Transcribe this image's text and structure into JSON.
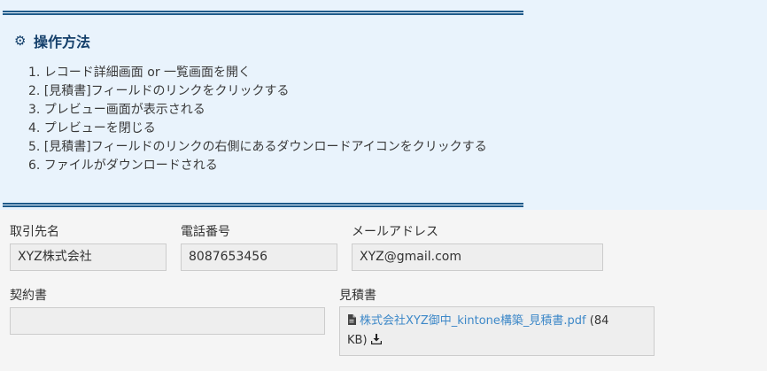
{
  "info_panel": {
    "title": "操作方法",
    "title_icon": "gear-icon",
    "steps": [
      "1. レコード詳細画面 or 一覧画面を開く",
      "2. [見積書]フィールドのリンクをクリックする",
      "3. プレビュー画面が表示される",
      "4. プレビューを閉じる",
      "5. [見積書]フィールドのリンクの右側にあるダウンロードアイコンをクリックする",
      "6. ファイルがダウンロードされる"
    ]
  },
  "form": {
    "customer": {
      "label": "取引先名",
      "value": "XYZ株式会社"
    },
    "phone": {
      "label": "電話番号",
      "value": "8087653456"
    },
    "email": {
      "label": "メールアドレス",
      "value": "XYZ@gmail.com"
    },
    "contract": {
      "label": "契約書",
      "value": ""
    },
    "estimate": {
      "label": "見積書",
      "file_name": "株式会社XYZ御中_kintone構築_見積書.pdf",
      "file_size_part1": " (84",
      "file_size_part2": "KB)",
      "file_icon": "file-icon",
      "download_icon": "download-icon"
    }
  },
  "colors": {
    "panel_bg": "#e9f3fc",
    "accent": "#1e5a8a",
    "link": "#3d88c8",
    "form_bg": "#f5f5f5"
  }
}
